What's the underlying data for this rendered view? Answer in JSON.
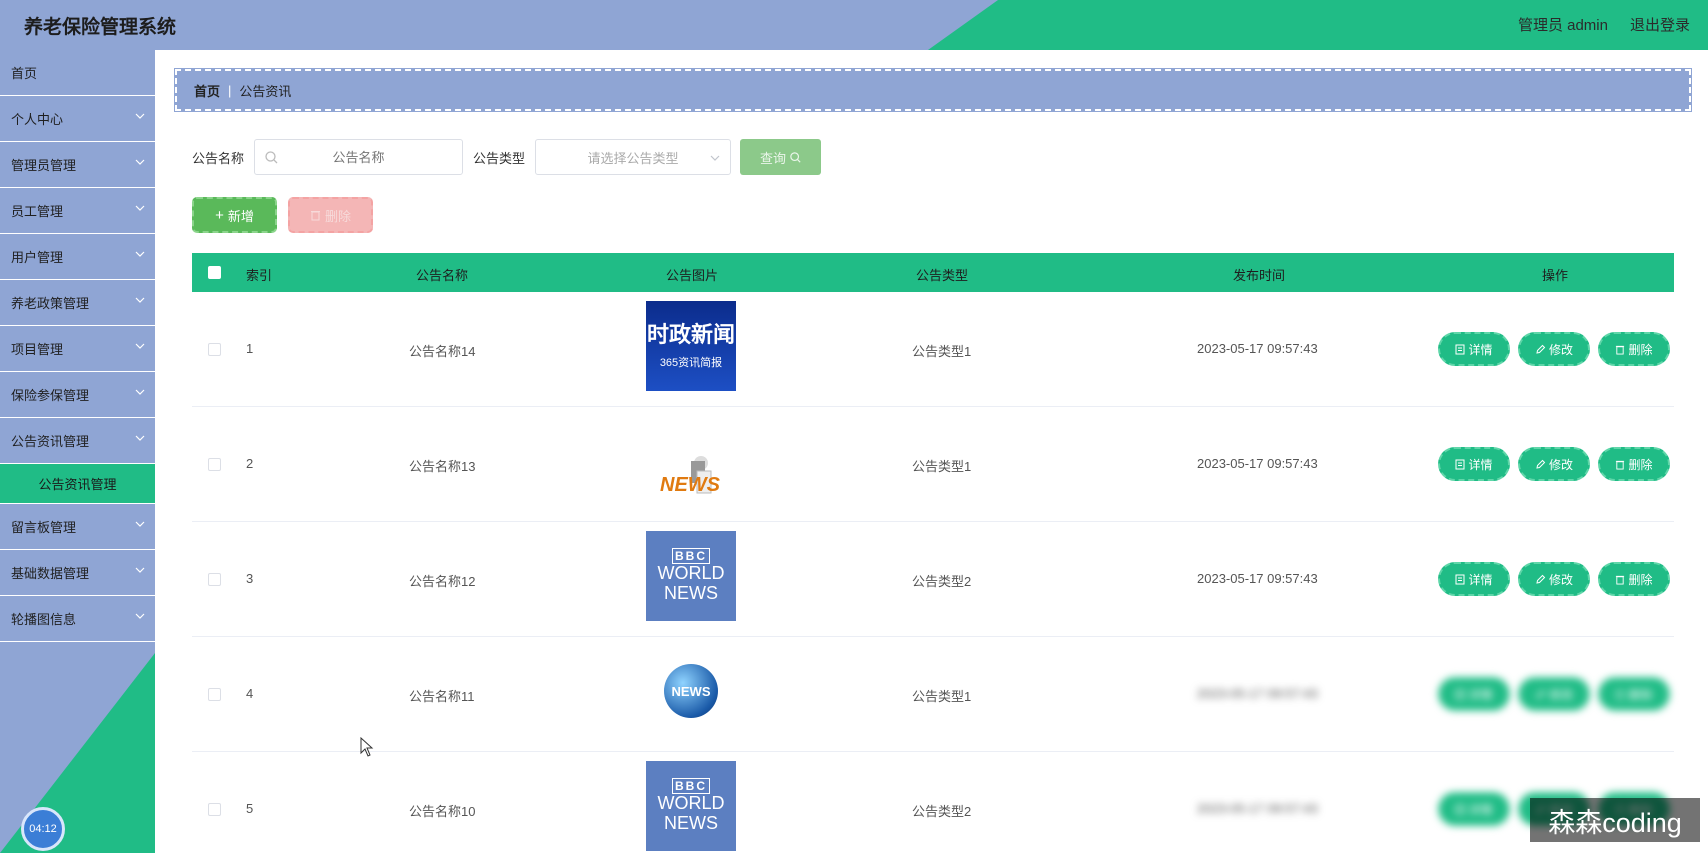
{
  "header": {
    "app_title": "养老保险管理系统",
    "user_label": "管理员 admin",
    "logout_label": "退出登录"
  },
  "sidebar": {
    "items": [
      {
        "label": "首页",
        "expandable": false
      },
      {
        "label": "个人中心",
        "expandable": true
      },
      {
        "label": "管理员管理",
        "expandable": true
      },
      {
        "label": "员工管理",
        "expandable": true
      },
      {
        "label": "用户管理",
        "expandable": true
      },
      {
        "label": "养老政策管理",
        "expandable": true
      },
      {
        "label": "项目管理",
        "expandable": true
      },
      {
        "label": "保险参保管理",
        "expandable": true
      },
      {
        "label": "公告资讯管理",
        "expandable": true
      },
      {
        "label": "留言板管理",
        "expandable": true
      },
      {
        "label": "基础数据管理",
        "expandable": true
      },
      {
        "label": "轮播图信息",
        "expandable": true
      }
    ],
    "active_sub": "公告资讯管理",
    "timer": "04:12"
  },
  "breadcrumb": {
    "home": "首页",
    "current": "公告资讯"
  },
  "search": {
    "name_label": "公告名称",
    "name_placeholder": "公告名称",
    "type_label": "公告类型",
    "type_placeholder": "请选择公告类型",
    "query_label": "查询"
  },
  "actions": {
    "add_label": "新增",
    "delete_label": "删除"
  },
  "table": {
    "headers": {
      "index": "索引",
      "name": "公告名称",
      "image": "公告图片",
      "type": "公告类型",
      "time": "发布时间",
      "ops": "操作"
    },
    "rows": [
      {
        "index": "1",
        "name": "公告名称14",
        "image": "时政新闻 365资讯简报",
        "type": "公告类型1",
        "time": "2023-05-17 09:57:43"
      },
      {
        "index": "2",
        "name": "公告名称13",
        "image": "NEWS",
        "type": "公告类型1",
        "time": "2023-05-17 09:57:43"
      },
      {
        "index": "3",
        "name": "公告名称12",
        "image": "BBC WORLD NEWS",
        "type": "公告类型2",
        "time": "2023-05-17 09:57:43"
      },
      {
        "index": "4",
        "name": "公告名称11",
        "image": "NEWS globe",
        "type": "公告类型1",
        "time": "2023-05-17 09:57:43"
      },
      {
        "index": "5",
        "name": "公告名称10",
        "image": "BBC WORLD NEWS",
        "type": "公告类型2",
        "time": "2023-05-17 09:57:43"
      }
    ],
    "op_labels": {
      "detail": "详情",
      "edit": "修改",
      "delete": "删除"
    }
  },
  "image_text": {
    "politics_top": "时政新闻",
    "politics_bottom": "365资讯简报",
    "news": "NEWS",
    "bbc": "BBC",
    "world": "WORLD",
    "news_caps": "NEWS",
    "globe": "NEWS"
  },
  "watermark": "森森coding",
  "colors": {
    "accent_green": "#20bc86",
    "sidebar_blue": "#8fa5d4"
  }
}
